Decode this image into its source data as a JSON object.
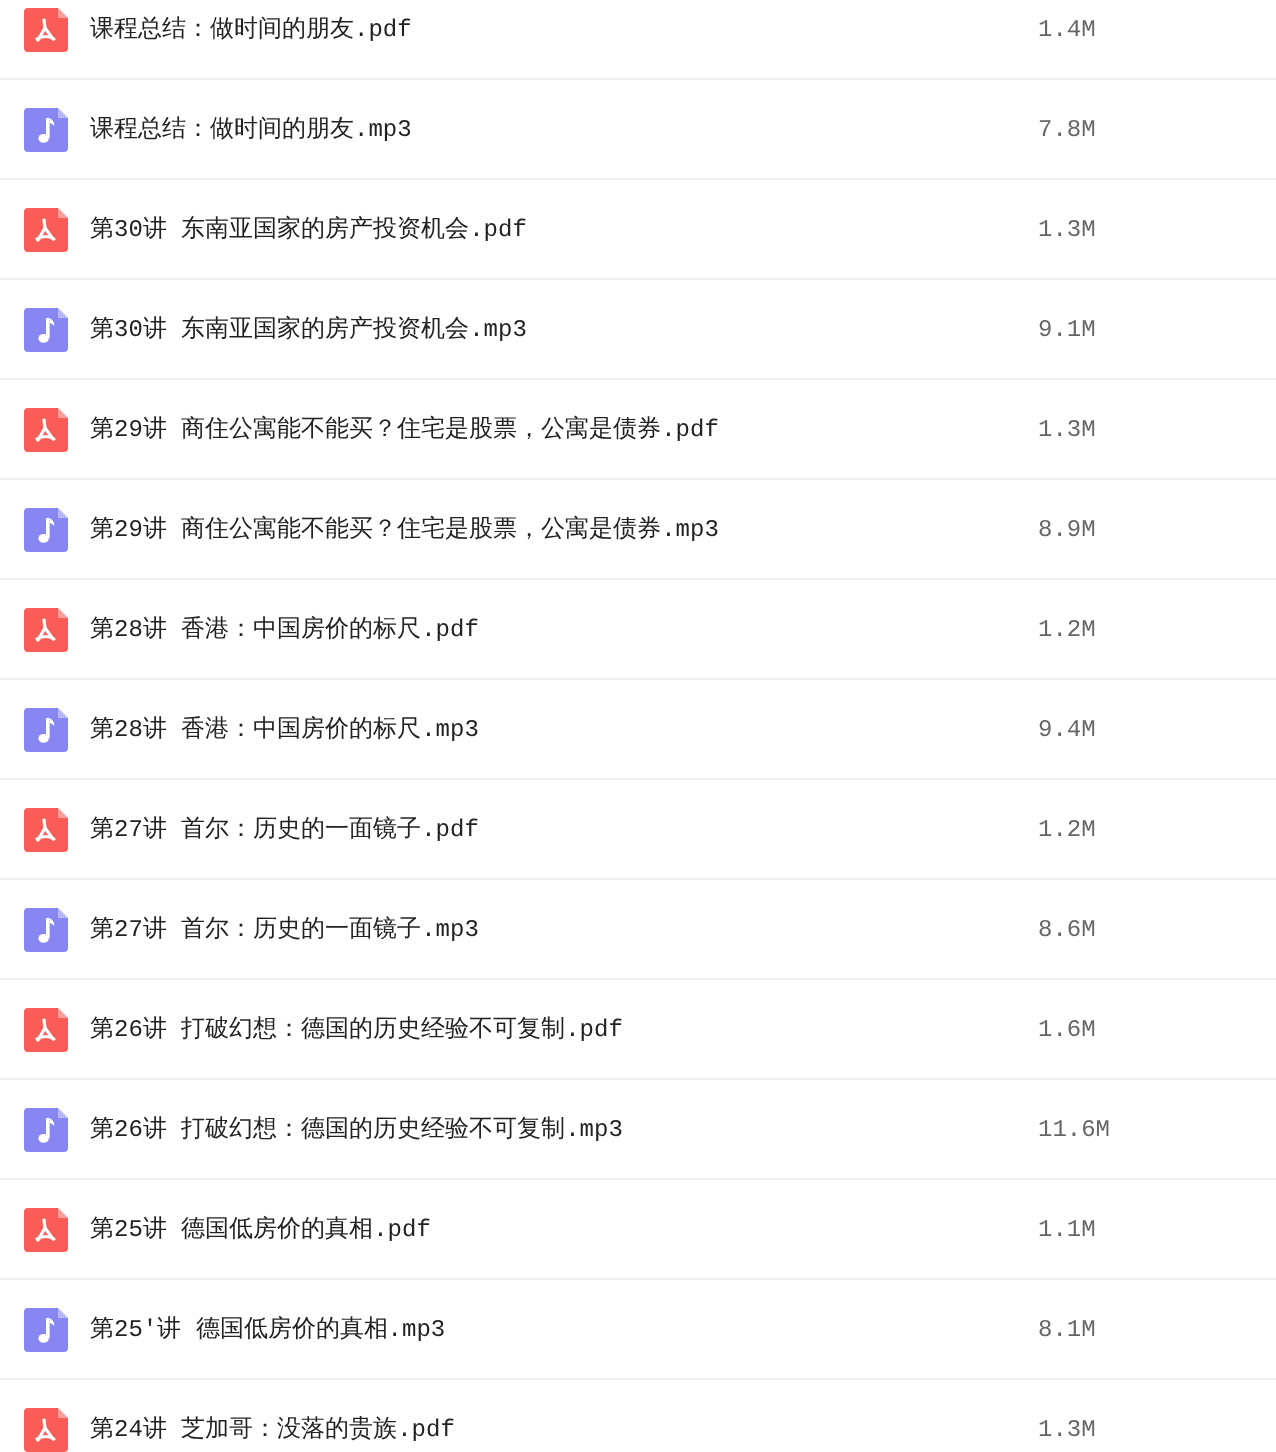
{
  "files": [
    {
      "kind": "pdf",
      "name": "课程总结：做时间的朋友.pdf",
      "size": "1.4M"
    },
    {
      "kind": "mp3",
      "name": "课程总结：做时间的朋友.mp3",
      "size": "7.8M"
    },
    {
      "kind": "pdf",
      "name": "第30讲 东南亚国家的房产投资机会.pdf",
      "size": "1.3M"
    },
    {
      "kind": "mp3",
      "name": "第30讲 东南亚国家的房产投资机会.mp3",
      "size": "9.1M"
    },
    {
      "kind": "pdf",
      "name": "第29讲 商住公寓能不能买？住宅是股票，公寓是债券.pdf",
      "size": "1.3M"
    },
    {
      "kind": "mp3",
      "name": "第29讲 商住公寓能不能买？住宅是股票，公寓是债券.mp3",
      "size": "8.9M"
    },
    {
      "kind": "pdf",
      "name": "第28讲 香港：中国房价的标尺.pdf",
      "size": "1.2M"
    },
    {
      "kind": "mp3",
      "name": "第28讲 香港：中国房价的标尺.mp3",
      "size": "9.4M"
    },
    {
      "kind": "pdf",
      "name": "第27讲 首尔：历史的一面镜子.pdf",
      "size": "1.2M"
    },
    {
      "kind": "mp3",
      "name": "第27讲 首尔：历史的一面镜子.mp3",
      "size": "8.6M"
    },
    {
      "kind": "pdf",
      "name": "第26讲 打破幻想：德国的历史经验不可复制.pdf",
      "size": "1.6M"
    },
    {
      "kind": "mp3",
      "name": "第26讲 打破幻想：德国的历史经验不可复制.mp3",
      "size": "11.6M"
    },
    {
      "kind": "pdf",
      "name": "第25讲 德国低房价的真相.pdf",
      "size": "1.1M"
    },
    {
      "kind": "mp3",
      "name": "第25'讲 德国低房价的真相.mp3",
      "size": "8.1M"
    },
    {
      "kind": "pdf",
      "name": "第24讲 芝加哥：没落的贵族.pdf",
      "size": "1.3M"
    }
  ]
}
